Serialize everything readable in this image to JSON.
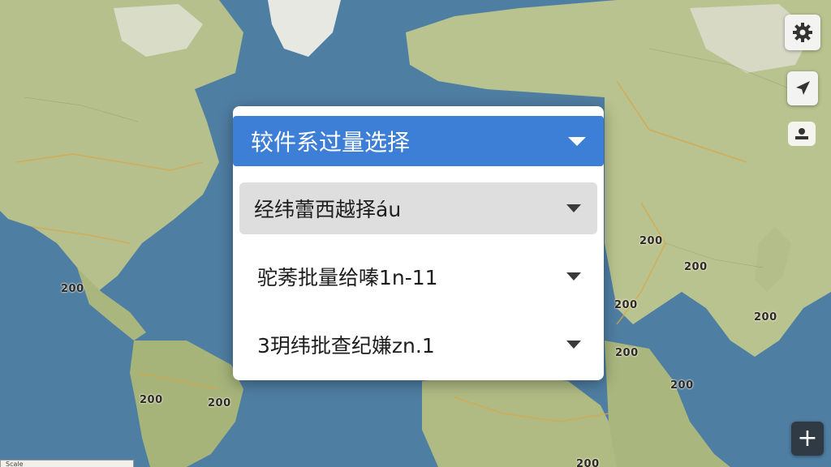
{
  "map": {
    "labels": [
      "200",
      "200",
      "200",
      "200",
      "200",
      "200",
      "200",
      "200",
      "200",
      "200"
    ],
    "scale_text": "Scale"
  },
  "controls": {
    "settings_icon": "gear-icon",
    "navigate_icon": "navigation-arrow-icon",
    "person_icon": "person-icon",
    "zoom_in_label": "+"
  },
  "panel": {
    "header_title": "较件系过量选择",
    "options": [
      {
        "label": "经纬蕾西越择áu"
      },
      {
        "label": "驼莠批量给嗪1n-11"
      },
      {
        "label": "3玥纬批查纪嫌zn.1"
      }
    ]
  },
  "colors": {
    "ocean": "#4f7ea3",
    "land": "#b9c48f",
    "header_blue": "#3d7fd6",
    "selected_option_bg": "#dedede"
  }
}
